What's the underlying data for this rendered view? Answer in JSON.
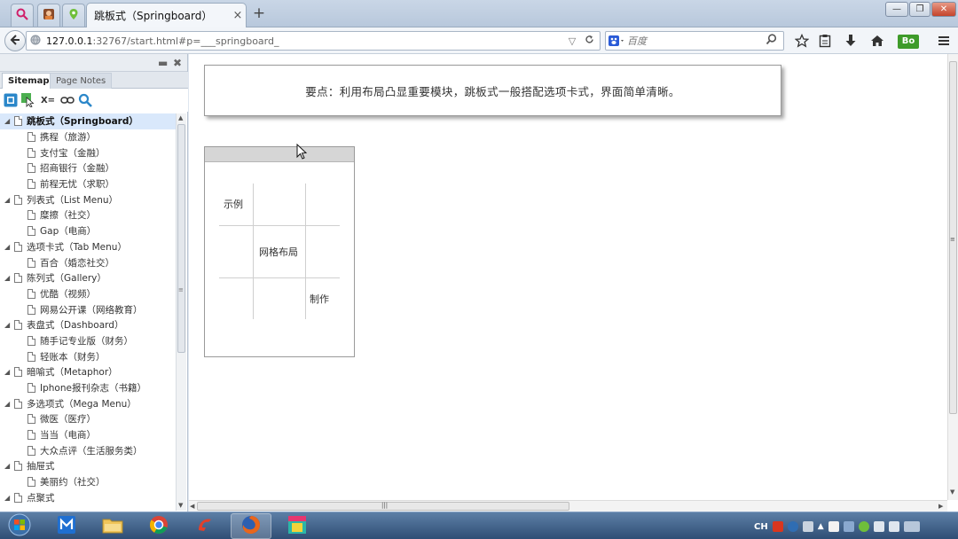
{
  "browser": {
    "active_tab_title": "跳板式（Springboard）",
    "tab_close": "×",
    "new_tab": "+",
    "url_host": "127.0.0.1",
    "url_rest": ":32767/start.html#p=___springboard_",
    "search_placeholder": "百度",
    "addon_label": "Bo"
  },
  "sidebar": {
    "tabs": [
      {
        "label": "Sitemap",
        "active": true
      },
      {
        "label": "Page Notes",
        "active": false
      }
    ],
    "tree": [
      {
        "label": "跳板式（Springboard）",
        "level": 0,
        "expanded": true,
        "selected": true
      },
      {
        "label": "携程（旅游）",
        "level": 1
      },
      {
        "label": "支付宝（金融）",
        "level": 1
      },
      {
        "label": "招商银行（金融）",
        "level": 1
      },
      {
        "label": "前程无忧（求职）",
        "level": 1
      },
      {
        "label": "列表式（List Menu）",
        "level": 0,
        "expanded": true
      },
      {
        "label": "糜擦（社交）",
        "level": 1
      },
      {
        "label": "Gap（电商）",
        "level": 1
      },
      {
        "label": "选项卡式（Tab Menu）",
        "level": 0,
        "expanded": true
      },
      {
        "label": "百合（婚恋社交）",
        "level": 1
      },
      {
        "label": "陈列式（Gallery）",
        "level": 0,
        "expanded": true
      },
      {
        "label": "优酷（视频）",
        "level": 1
      },
      {
        "label": "网易公开课（网络教育）",
        "level": 1
      },
      {
        "label": "表盘式（Dashboard）",
        "level": 0,
        "expanded": true
      },
      {
        "label": "随手记专业版（财务）",
        "level": 1
      },
      {
        "label": "轻账本（财务）",
        "level": 1
      },
      {
        "label": "暗喻式（Metaphor）",
        "level": 0,
        "expanded": true
      },
      {
        "label": "Iphone报刊杂志（书籍）",
        "level": 1
      },
      {
        "label": "多选项式（Mega Menu）",
        "level": 0,
        "expanded": true
      },
      {
        "label": "微医（医疗）",
        "level": 1
      },
      {
        "label": "当当（电商）",
        "level": 1
      },
      {
        "label": "大众点评（生活服务类）",
        "level": 1
      },
      {
        "label": "抽屉式",
        "level": 0,
        "expanded": true
      },
      {
        "label": "美丽约（社交）",
        "level": 1
      },
      {
        "label": "点聚式",
        "level": 0,
        "expanded": true
      }
    ]
  },
  "content": {
    "note": "要点：利用布局凸显重要模块，跳板式一般搭配选项卡式，界面简单清晰。",
    "phone": {
      "label_example": "示例",
      "label_grid": "网格布局",
      "label_make": "制作"
    }
  },
  "taskbar": {
    "tray_lang": "CH"
  }
}
